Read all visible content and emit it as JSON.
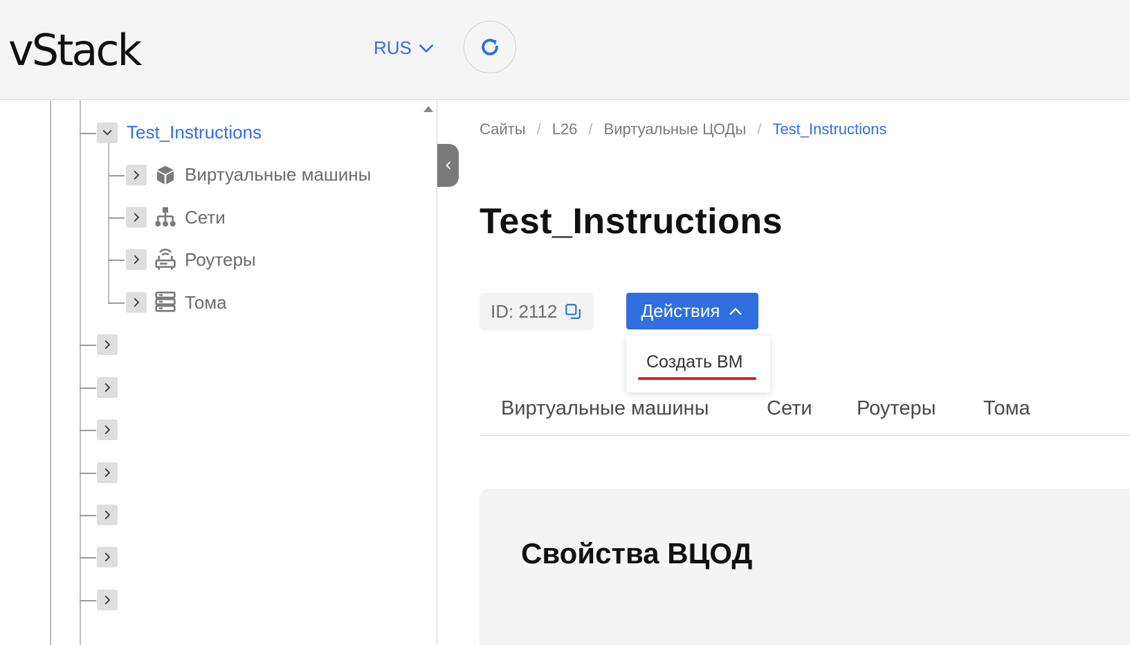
{
  "header": {
    "logo": "vStack",
    "language": "RUS"
  },
  "tree": {
    "active_node": "Test_Instructions",
    "children": [
      {
        "label": "Виртуальные машины",
        "icon": "cube-icon"
      },
      {
        "label": "Сети",
        "icon": "network-icon"
      },
      {
        "label": "Роутеры",
        "icon": "router-icon"
      },
      {
        "label": "Тома",
        "icon": "volumes-icon"
      }
    ],
    "collapsed_siblings": 7
  },
  "breadcrumb": {
    "items": [
      "Сайты",
      "L26",
      "Виртуальные ЦОДы"
    ],
    "current": "Test_Instructions"
  },
  "page": {
    "title": "Test_Instructions",
    "id_label": "ID: 2112"
  },
  "actions": {
    "label": "Действия",
    "menu_items": [
      "Создать ВМ"
    ]
  },
  "tabs": [
    "Виртуальные машины",
    "Сети",
    "Роутеры",
    "Тома"
  ],
  "properties": {
    "title": "Свойства ВЦОД"
  },
  "colors": {
    "accent": "#2f6fe0",
    "highlight_underline": "#e11d2a",
    "header_bg": "#f5f5f5",
    "card_bg": "#f4f4f4"
  }
}
